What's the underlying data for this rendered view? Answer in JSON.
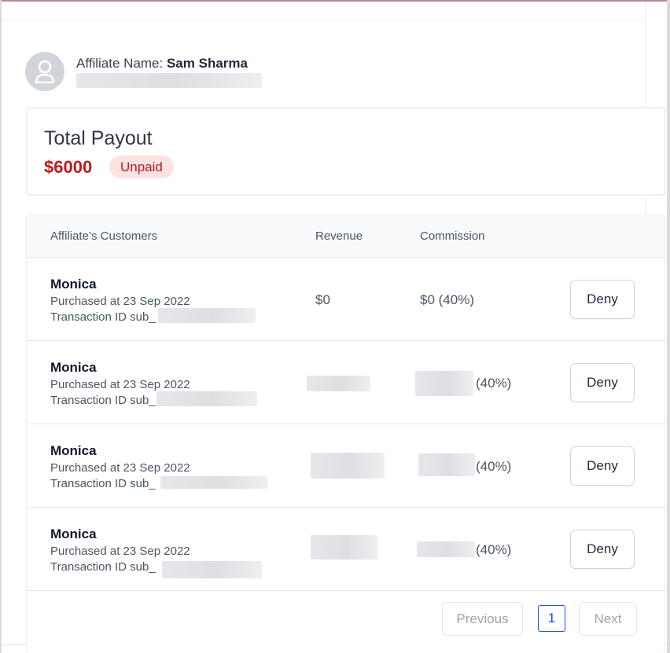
{
  "affiliate": {
    "label": "Affiliate Name:",
    "name": "Sam Sharma"
  },
  "payout": {
    "title": "Total Payout",
    "amount": "$6000",
    "status": "Unpaid"
  },
  "colors": {
    "amount": "#b91c1c",
    "badge_bg": "#fde2e2",
    "page_active": "#1d4ed8"
  },
  "table": {
    "headers": {
      "customers": "Affiliate’s Customers",
      "revenue": "Revenue",
      "commission": "Commission"
    },
    "rows": [
      {
        "name": "Monica",
        "purchased": "Purchased at 23 Sep 2022",
        "txn_prefix": "Transaction ID sub_",
        "revenue": "$0",
        "commission": "$0 (40%)",
        "action": "Deny"
      },
      {
        "name": "Monica",
        "purchased": "Purchased at 23 Sep 2022",
        "txn_prefix": "Transaction ID sub_",
        "commission_pct": "(40%)",
        "action": "Deny"
      },
      {
        "name": "Monica",
        "purchased": "Purchased at 23 Sep 2022",
        "txn_prefix": "Transaction ID sub_",
        "commission_pct": "(40%)",
        "action": "Deny"
      },
      {
        "name": "Monica",
        "purchased": "Purchased at 23 Sep 2022",
        "txn_prefix": "Transaction ID sub_",
        "commission_pct": "(40%)",
        "action": "Deny"
      }
    ]
  },
  "pagination": {
    "previous": "Previous",
    "current_page": "1",
    "next": "Next"
  }
}
